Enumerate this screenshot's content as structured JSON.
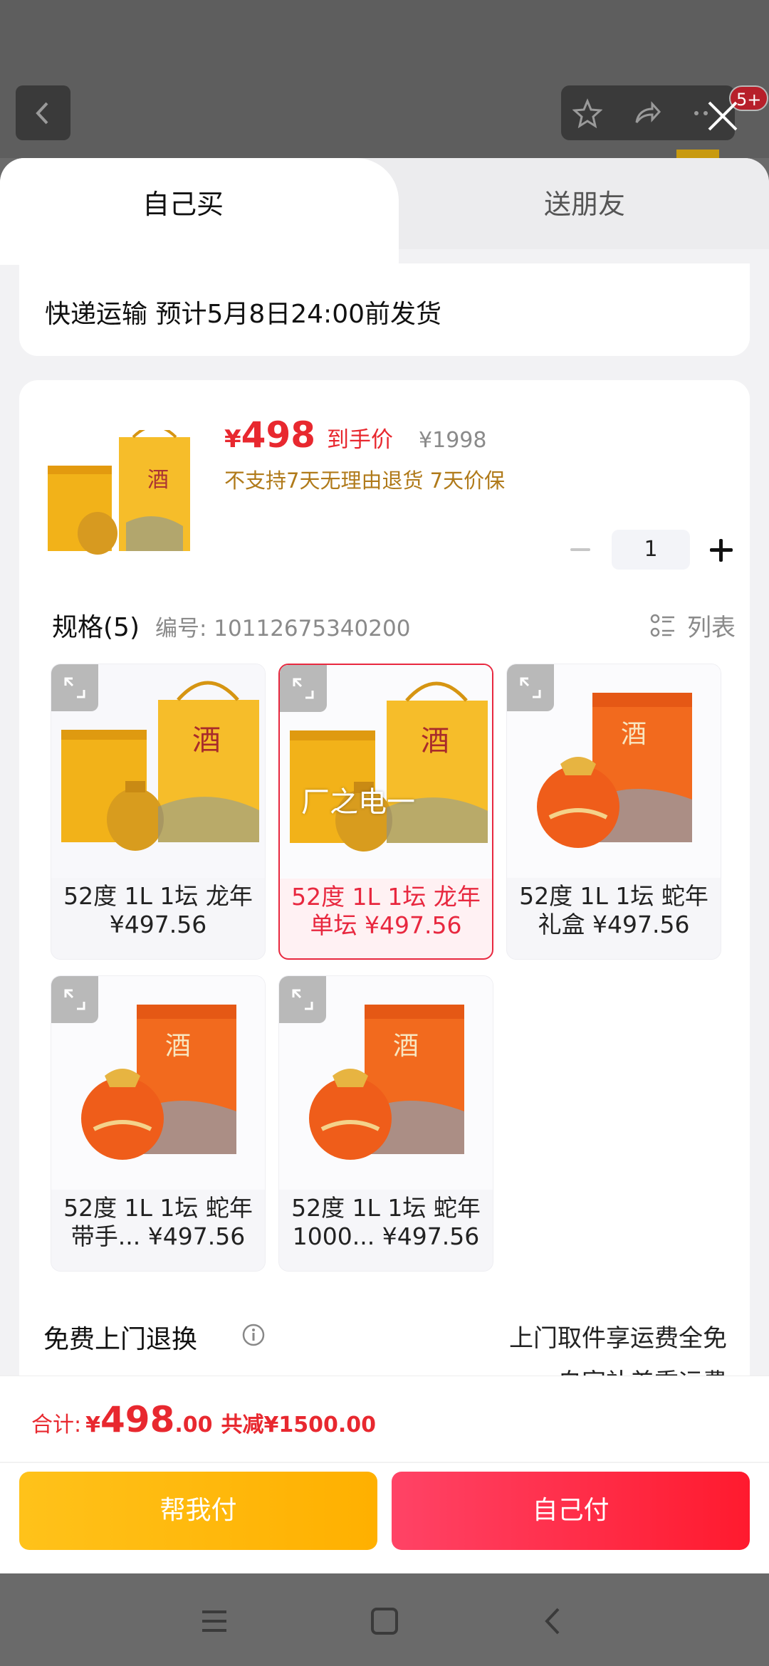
{
  "header": {
    "notification_badge": "5+"
  },
  "tabs": [
    {
      "label": "自己买"
    },
    {
      "label": "送朋友"
    }
  ],
  "shipping": {
    "text": "快递运输 预计5月8日24:00前发货"
  },
  "product": {
    "currency": "¥",
    "price": "498",
    "price_tag": "到手价",
    "original_price": "¥1998",
    "policy": "不支持7天无理由退货  7天价保",
    "quantity": "1"
  },
  "spec": {
    "title": "规格(5)",
    "code": "编号: 10112675340200",
    "list_label": "列表",
    "items": [
      {
        "name": "52度 1L 1坛 龙年 ¥497.56",
        "selected": false
      },
      {
        "name": "52度 1L 1坛 龙年 单坛  ¥497.56",
        "selected": true
      },
      {
        "name": "52度 1L 1坛 蛇年 礼盒  ¥497.56",
        "selected": false
      },
      {
        "name": "52度 1L 1坛 蛇年 带手...  ¥497.56",
        "selected": false
      },
      {
        "name": "52度 1L 1坛 蛇年 1000...  ¥497.56",
        "selected": false
      }
    ],
    "watermark": "厂之电一"
  },
  "return_service": {
    "title": "免费上门退换",
    "desc": "上门取件享运费全免",
    "desc2": "自家补差重运费"
  },
  "footer": {
    "total_label": "合计:",
    "currency": "¥",
    "total_int": "498",
    "total_cents": ".00",
    "savings": "共减¥1500.00",
    "help_pay": "帮我付",
    "self_pay": "自己付"
  },
  "colors": {
    "accent_red": "#e8282f",
    "help_btn": "#ffb000",
    "self_btn": "#ff1a2e"
  }
}
